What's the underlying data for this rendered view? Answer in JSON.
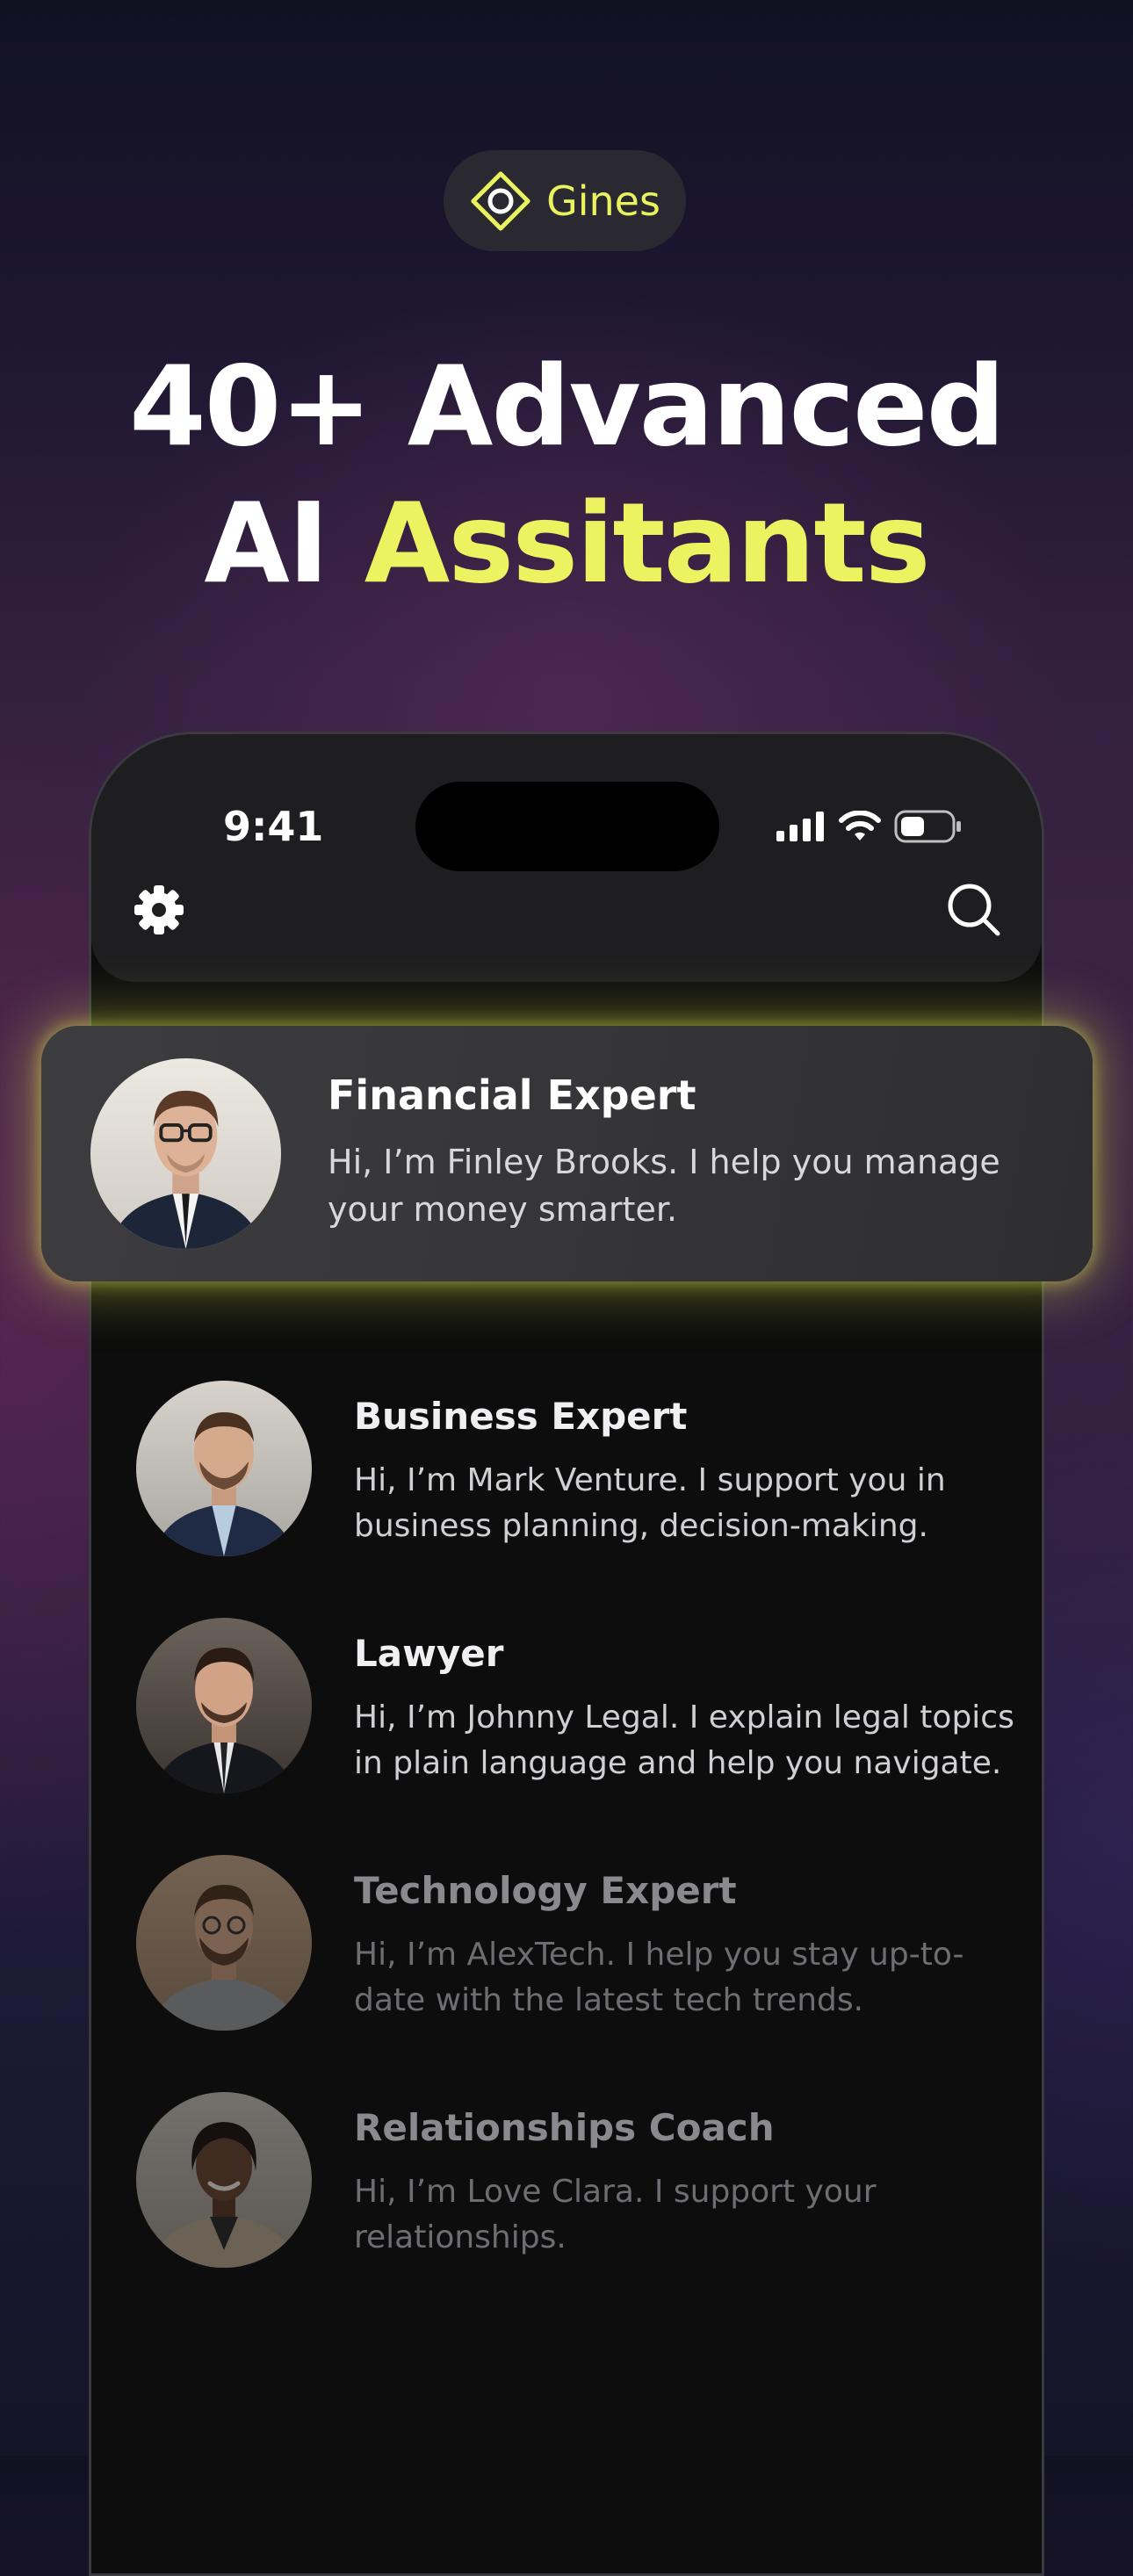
{
  "brand": {
    "name": "Gines",
    "accent_color": "#e9f35e",
    "logo_icon": "diamond-ring-icon"
  },
  "headline": {
    "line1": "40+ Advanced",
    "line2_plain": "AI",
    "line2_accent": "Assitants"
  },
  "status_bar": {
    "time": "9:41",
    "icons": [
      "cellular-signal-icon",
      "wifi-icon",
      "battery-icon"
    ]
  },
  "header": {
    "left_icon": "gear-icon",
    "right_icon": "search-icon"
  },
  "featured": {
    "title": "Financial Expert",
    "description": "Hi, I’m Finley Brooks. I help you manage your money smarter.",
    "highlight_color": "#dfec46"
  },
  "assistants": [
    {
      "title": "Business Expert",
      "description": " Hi, I’m Mark Venture. I support you in business planning, decision-making."
    },
    {
      "title": "Lawyer",
      "description": " Hi, I’m Johnny Legal. I explain legal topics in plain language and help you navigate."
    },
    {
      "title": "Technology Expert",
      "description": "Hi, I’m AlexTech. I help you stay up-to-date with the latest tech trends."
    },
    {
      "title": "Relationships Coach",
      "description": "Hi, I’m Love Clara. I support your relationships."
    }
  ]
}
